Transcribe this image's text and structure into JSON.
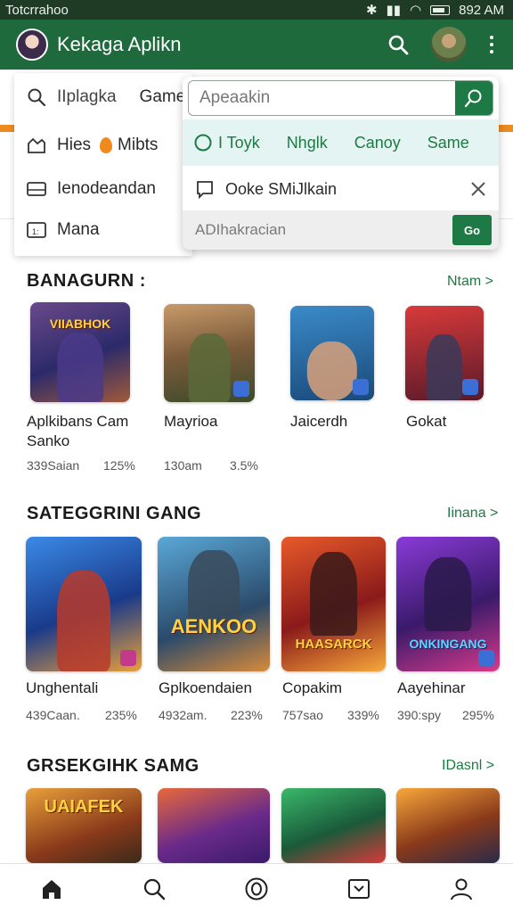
{
  "status_bar": {
    "left_text": "Totcrrahoo",
    "time": "892 AM"
  },
  "app_bar": {
    "title": "Kekaga Aplikn",
    "icons": [
      "avatar",
      "search-icon",
      "user-avatar",
      "more-vert-icon"
    ]
  },
  "side_menu": {
    "search_label": "IIplagka",
    "games_label": "Game",
    "items": [
      {
        "icon": "chart-icon",
        "label": "Hies",
        "extra": "Mibts"
      },
      {
        "icon": "monitor-icon",
        "label": "Ienodeandan"
      },
      {
        "icon": "calendar-icon",
        "label": "Mana"
      }
    ]
  },
  "search_popup": {
    "placeholder": "Apeaakin",
    "chips": [
      "I Toyk",
      "Nhglk",
      "Canoy",
      "Same"
    ],
    "recent": "Ooke SMiJlkain",
    "footer_text": "ADIhakracian",
    "footer_button": "Go"
  },
  "sections": [
    {
      "title": "BANAGURN :",
      "link": "Ntam >",
      "games": [
        {
          "name": "Aplkibans Cam Sanko",
          "meta1": "339Saian",
          "meta2": "125%"
        },
        {
          "name": "Mayrioa",
          "meta1": "130am",
          "meta2": "3.5%"
        },
        {
          "name": "Jaicerdh",
          "meta1": "",
          "meta2": ""
        },
        {
          "name": "Gokat",
          "meta1": "",
          "meta2": ""
        }
      ]
    },
    {
      "title": "SATEGGRINI GANG",
      "link": "Iinana >",
      "games": [
        {
          "name": "Unghentali",
          "meta1": "439Caan.",
          "meta2": "235%"
        },
        {
          "name": "Gplkoendaien",
          "meta1": "4932am.",
          "meta2": "223%"
        },
        {
          "name": "Copakim",
          "meta1": "757sao",
          "meta2": "339%"
        },
        {
          "name": "Aayehinar",
          "meta1": "390:spy",
          "meta2": "295%"
        }
      ]
    },
    {
      "title": "GRSEKGIHK SAMG",
      "link": "IDasnl >",
      "games": []
    }
  ],
  "art_labels": {
    "s1g1": "VIIABHOK",
    "s2g2": "AENKOO",
    "s2g3": "HAASARCK",
    "s2g4": "ONKINGANG",
    "s3g1": "UAIAFEK"
  },
  "bottom_nav": [
    "home-icon",
    "search-icon",
    "circle-icon",
    "inbox-icon",
    "profile-icon"
  ]
}
